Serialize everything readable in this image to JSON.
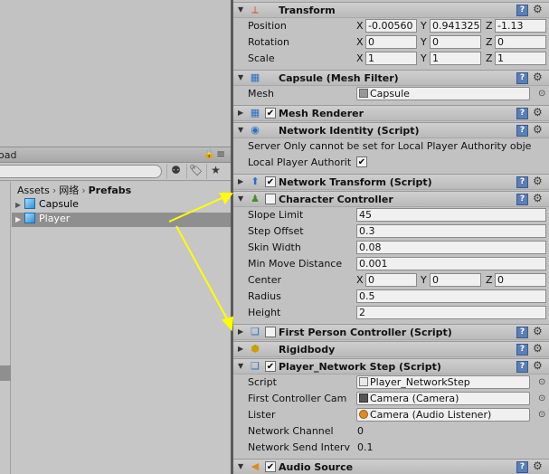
{
  "project": {
    "tab_label": "oad",
    "breadcrumb": [
      "Assets",
      "网络",
      "Prefabs"
    ],
    "files": [
      {
        "name": "Capsule"
      },
      {
        "name": "Player"
      }
    ]
  },
  "inspector": {
    "transform": {
      "title": "Transform",
      "position": {
        "label": "Position",
        "x": "-0.00560",
        "y": "0.941325",
        "z": "-1.13"
      },
      "rotation": {
        "label": "Rotation",
        "x": "0",
        "y": "0",
        "z": "0"
      },
      "scale": {
        "label": "Scale",
        "x": "1",
        "y": "1",
        "z": "1"
      }
    },
    "mesh_filter": {
      "title": "Capsule (Mesh Filter)",
      "mesh_label": "Mesh",
      "mesh_value": "Capsule"
    },
    "mesh_renderer": {
      "title": "Mesh Renderer"
    },
    "network_identity": {
      "title": "Network Identity (Script)",
      "warning": "Server Only cannot be set for Local Player Authority obje",
      "local_player_label": "Local Player Authorit"
    },
    "network_transform": {
      "title": "Network Transform (Script)"
    },
    "character_controller": {
      "title": "Character Controller",
      "slope_limit": {
        "label": "Slope Limit",
        "value": "45"
      },
      "step_offset": {
        "label": "Step Offset",
        "value": "0.3"
      },
      "skin_width": {
        "label": "Skin Width",
        "value": "0.08"
      },
      "min_move": {
        "label": "Min Move Distance",
        "value": "0.001"
      },
      "center": {
        "label": "Center",
        "x": "0",
        "y": "0",
        "z": "0"
      },
      "radius": {
        "label": "Radius",
        "value": "0.5"
      },
      "height": {
        "label": "Height",
        "value": "2"
      }
    },
    "first_person": {
      "title": "First Person Controller (Script)"
    },
    "rigidbody": {
      "title": "Rigidbody"
    },
    "player_network": {
      "title": "Player_Network Step (Script)",
      "script": {
        "label": "Script",
        "value": "Player_NetworkStep"
      },
      "first_cam": {
        "label": "First Controller Cam",
        "value": "Camera (Camera)"
      },
      "lister": {
        "label": "Lister",
        "value": "Camera (Audio Listener)"
      },
      "channel": {
        "label": "Network Channel",
        "value": "0"
      },
      "send_interval": {
        "label": "Network Send Interv",
        "value": "0.1"
      }
    },
    "audio_source": {
      "title": "Audio Source"
    },
    "axis_labels": {
      "x": "X",
      "y": "Y",
      "z": "Z"
    },
    "check_mark": "✔"
  },
  "colors": {
    "accent_icon": "#2f8fd8",
    "annotation_arrow": "#ffff00"
  }
}
